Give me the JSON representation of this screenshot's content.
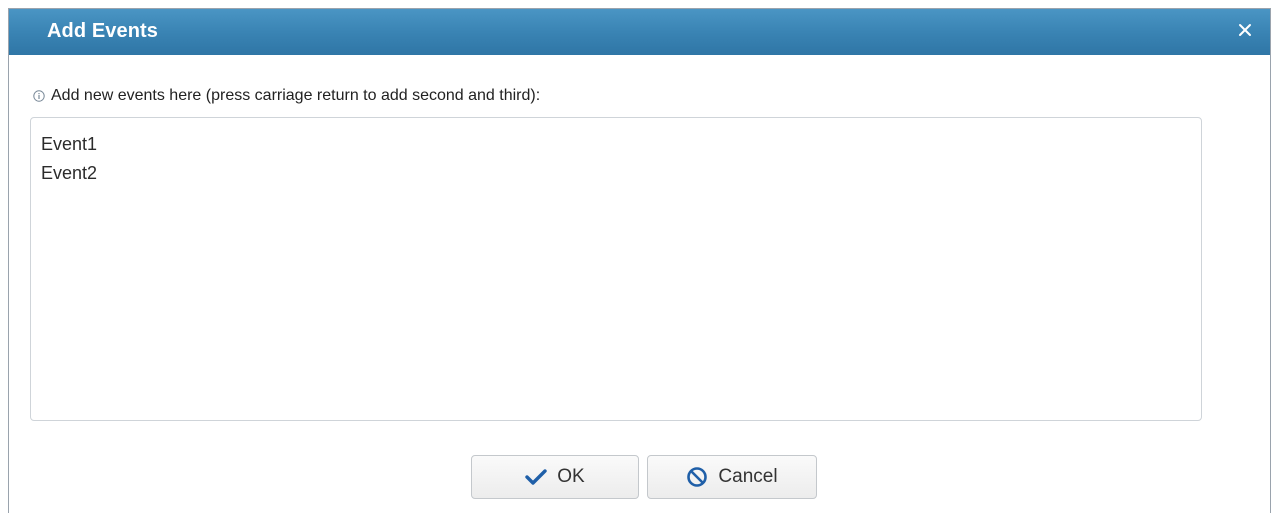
{
  "dialog": {
    "title": "Add Events",
    "close_icon": "close-icon"
  },
  "form": {
    "info_icon": "info-icon",
    "instruction": "Add new events here (press carriage return to add second and third):",
    "events_value": "Event1\nEvent2"
  },
  "buttons": {
    "ok": {
      "label": "OK",
      "icon": "checkmark-icon"
    },
    "cancel": {
      "label": "Cancel",
      "icon": "cancel-circle-icon"
    }
  },
  "colors": {
    "titlebar": "#3a84b4",
    "title_text": "#ffffff",
    "icon_blue": "#1f5fa8"
  }
}
